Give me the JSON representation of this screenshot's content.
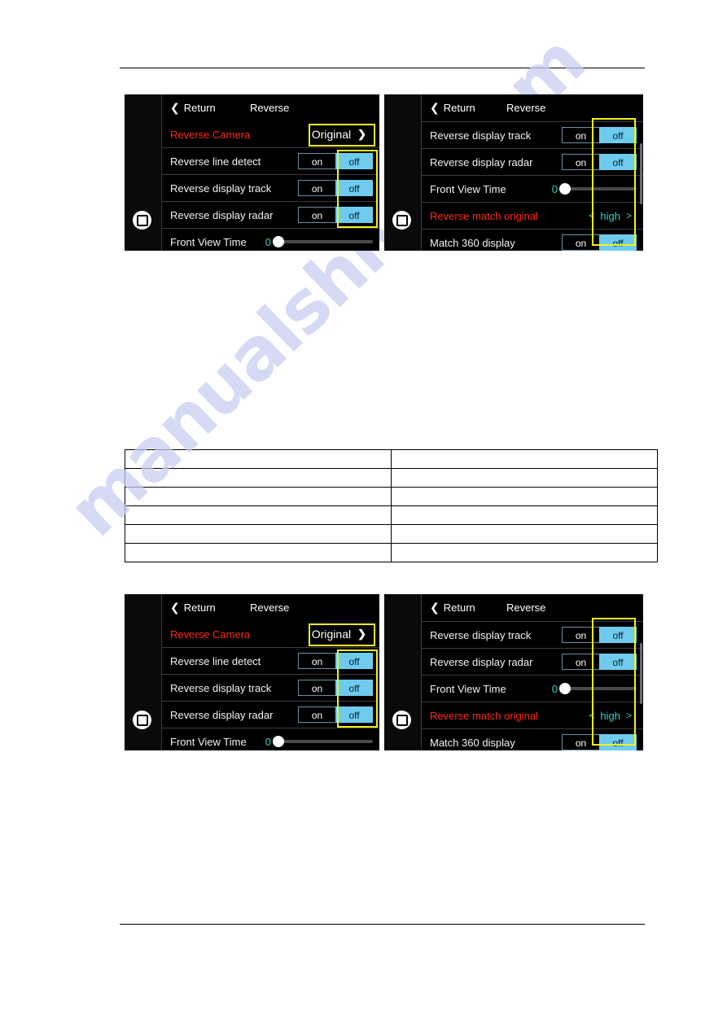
{
  "document": {
    "background": "#ffffff",
    "rules": [
      "top",
      "bottom"
    ],
    "watermark": "manualshive.com",
    "watermark_color": "#c9cdf0"
  },
  "colors": {
    "screen_background": "#000000",
    "label": "#f2f2f2",
    "alert_label": "#ff2a16",
    "toggle_off_bg": "#6ecbee",
    "toggle_off_text": "#07222e",
    "toggle_on_text": "#ffffff",
    "value_teal": "#2fd0c8",
    "highlight_border": "#f0f020"
  },
  "table": {
    "columns": 2,
    "rows": 6,
    "cells": [
      [
        "",
        ""
      ],
      [
        "",
        ""
      ],
      [
        "",
        ""
      ],
      [
        "",
        ""
      ],
      [
        "",
        ""
      ],
      [
        "",
        ""
      ]
    ]
  },
  "figure": {
    "left_panel": {
      "home_icon": "home-square-icon",
      "titlebar": {
        "back_icon": "chevron-left-icon",
        "back_label": "Return",
        "title": "Reverse"
      },
      "rows": [
        {
          "label": "Reverse Camera",
          "alert": true,
          "control": "pill",
          "value": "Original",
          "chevron": "chevron-right-icon",
          "highlighted": true
        },
        {
          "label": "Reverse line detect",
          "alert": false,
          "control": "segmented",
          "options": [
            "on",
            "off"
          ],
          "selected": "off"
        },
        {
          "label": "Reverse display track",
          "alert": false,
          "control": "segmented",
          "options": [
            "on",
            "off"
          ],
          "selected": "off"
        },
        {
          "label": "Reverse display radar",
          "alert": false,
          "control": "segmented",
          "options": [
            "on",
            "off"
          ],
          "selected": "off"
        },
        {
          "label": "Front View Time",
          "alert": false,
          "control": "slider",
          "value": "0",
          "min": 0,
          "max": 10,
          "position_pct": 0
        }
      ]
    },
    "right_panel": {
      "home_icon": "home-square-icon",
      "titlebar": {
        "back_icon": "chevron-left-icon",
        "back_label": "Return",
        "title": "Reverse"
      },
      "rows": [
        {
          "label": "Reverse display track",
          "alert": false,
          "control": "segmented",
          "options": [
            "on",
            "off"
          ],
          "selected": "off"
        },
        {
          "label": "Reverse display radar",
          "alert": false,
          "control": "segmented",
          "options": [
            "on",
            "off"
          ],
          "selected": "off"
        },
        {
          "label": "Front View Time",
          "alert": false,
          "control": "slider",
          "value": "0",
          "min": 0,
          "max": 10,
          "position_pct": 0
        },
        {
          "label": "Reverse match original",
          "alert": true,
          "control": "chooser",
          "value": "high",
          "prev_icon": "chevron-left-icon",
          "next_icon": "chevron-right-icon"
        },
        {
          "label": "Match 360 display",
          "alert": false,
          "control": "segmented",
          "options": [
            "on",
            "off"
          ],
          "selected": "off"
        }
      ]
    }
  }
}
